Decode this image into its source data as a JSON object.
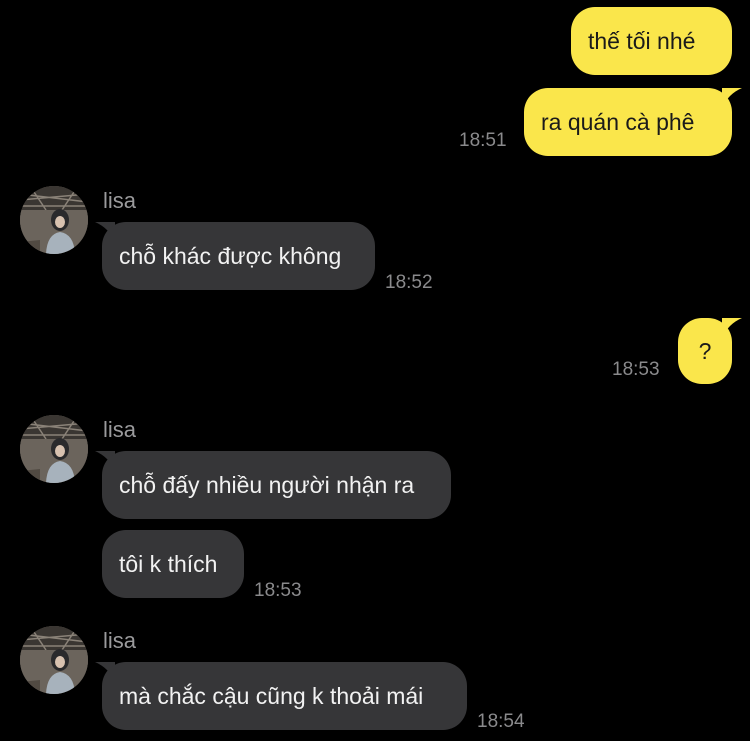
{
  "colors": {
    "background": "#000000",
    "outgoing_bubble": "#FAE64B",
    "incoming_bubble": "#363638",
    "timestamp": "#8A8A8C"
  },
  "messages": {
    "out_1": {
      "text": "thế tối nhé"
    },
    "out_2": {
      "text": "ra quán cà phê",
      "time": "18:51"
    },
    "group_1": {
      "sender": "lisa",
      "avatar_icon": "profile-photo-avatar",
      "msg_1": {
        "text": "chỗ khác được không",
        "time": "18:52"
      }
    },
    "out_3": {
      "text": "?",
      "time": "18:53"
    },
    "group_2": {
      "sender": "lisa",
      "avatar_icon": "profile-photo-avatar",
      "msg_1": {
        "text": "chỗ đấy nhiều người nhận ra"
      },
      "msg_2": {
        "text": "tôi k thích",
        "time": "18:53"
      }
    },
    "group_3": {
      "sender": "lisa",
      "avatar_icon": "profile-photo-avatar",
      "msg_1": {
        "text": "mà chắc cậu cũng k thoải mái",
        "time": "18:54"
      }
    }
  }
}
